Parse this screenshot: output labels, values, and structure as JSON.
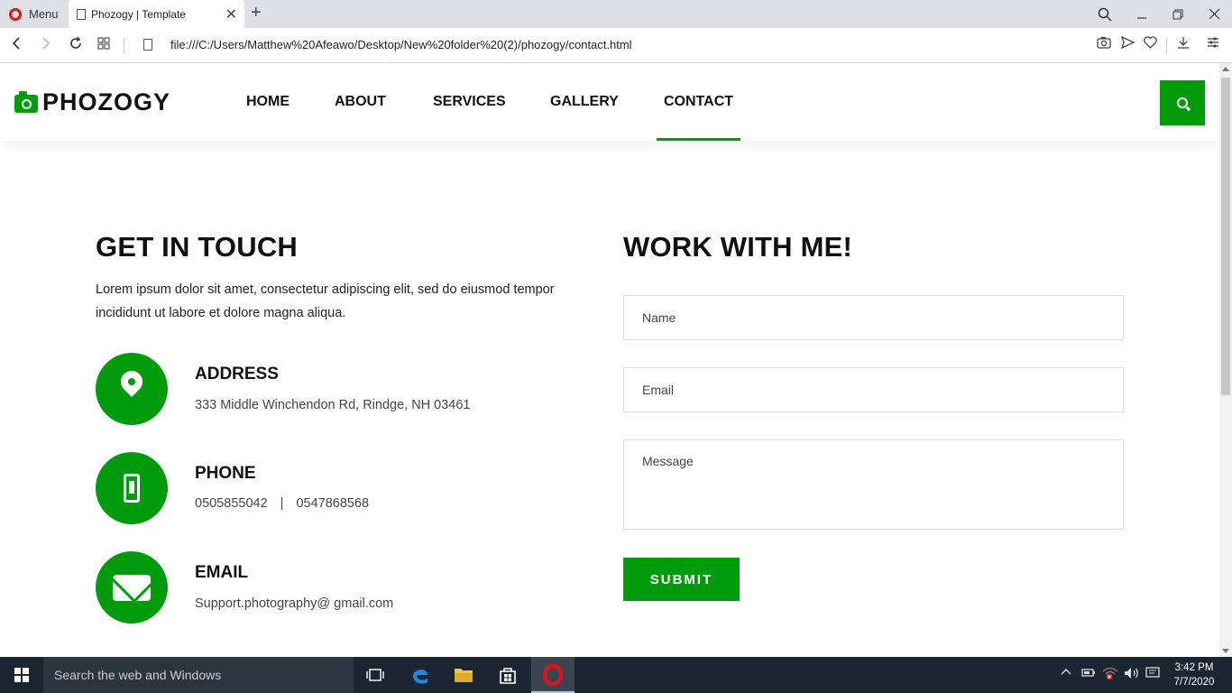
{
  "browser": {
    "menu_label": "Menu",
    "tab_title": "Phozogy | Template",
    "url": "file:///C:/Users/Matthew%20Afeawo/Desktop/New%20folder%20(2)/phozogy/contact.html"
  },
  "site": {
    "logo_text": "PHOZOGY",
    "nav": [
      {
        "label": "HOME"
      },
      {
        "label": "ABOUT"
      },
      {
        "label": "SERVICES"
      },
      {
        "label": "GALLERY"
      },
      {
        "label": "CONTACT"
      }
    ],
    "active_nav": "CONTACT",
    "accent_color": "#009a0d"
  },
  "contact": {
    "heading": "GET IN TOUCH",
    "intro": "Lorem ipsum dolor sit amet, consectetur adipiscing elit, sed do eiusmod tempor incididunt ut labore et dolore magna aliqua.",
    "address": {
      "title": "ADDRESS",
      "text": "333 Middle Winchendon Rd, Rindge, NH 03461"
    },
    "phone": {
      "title": "PHONE",
      "number1": "0505855042",
      "separator": "|",
      "number2": "0547868568"
    },
    "email": {
      "title": "EMAIL",
      "text": "Support.photography@ gmail.com"
    }
  },
  "form": {
    "heading": "WORK WITH ME!",
    "name_placeholder": "Name",
    "email_placeholder": "Email",
    "message_placeholder": "Message",
    "submit_label": "SUBMIT"
  },
  "taskbar": {
    "search_placeholder": "Search the web and Windows",
    "time": "3:42 PM",
    "date": "7/7/2020"
  }
}
